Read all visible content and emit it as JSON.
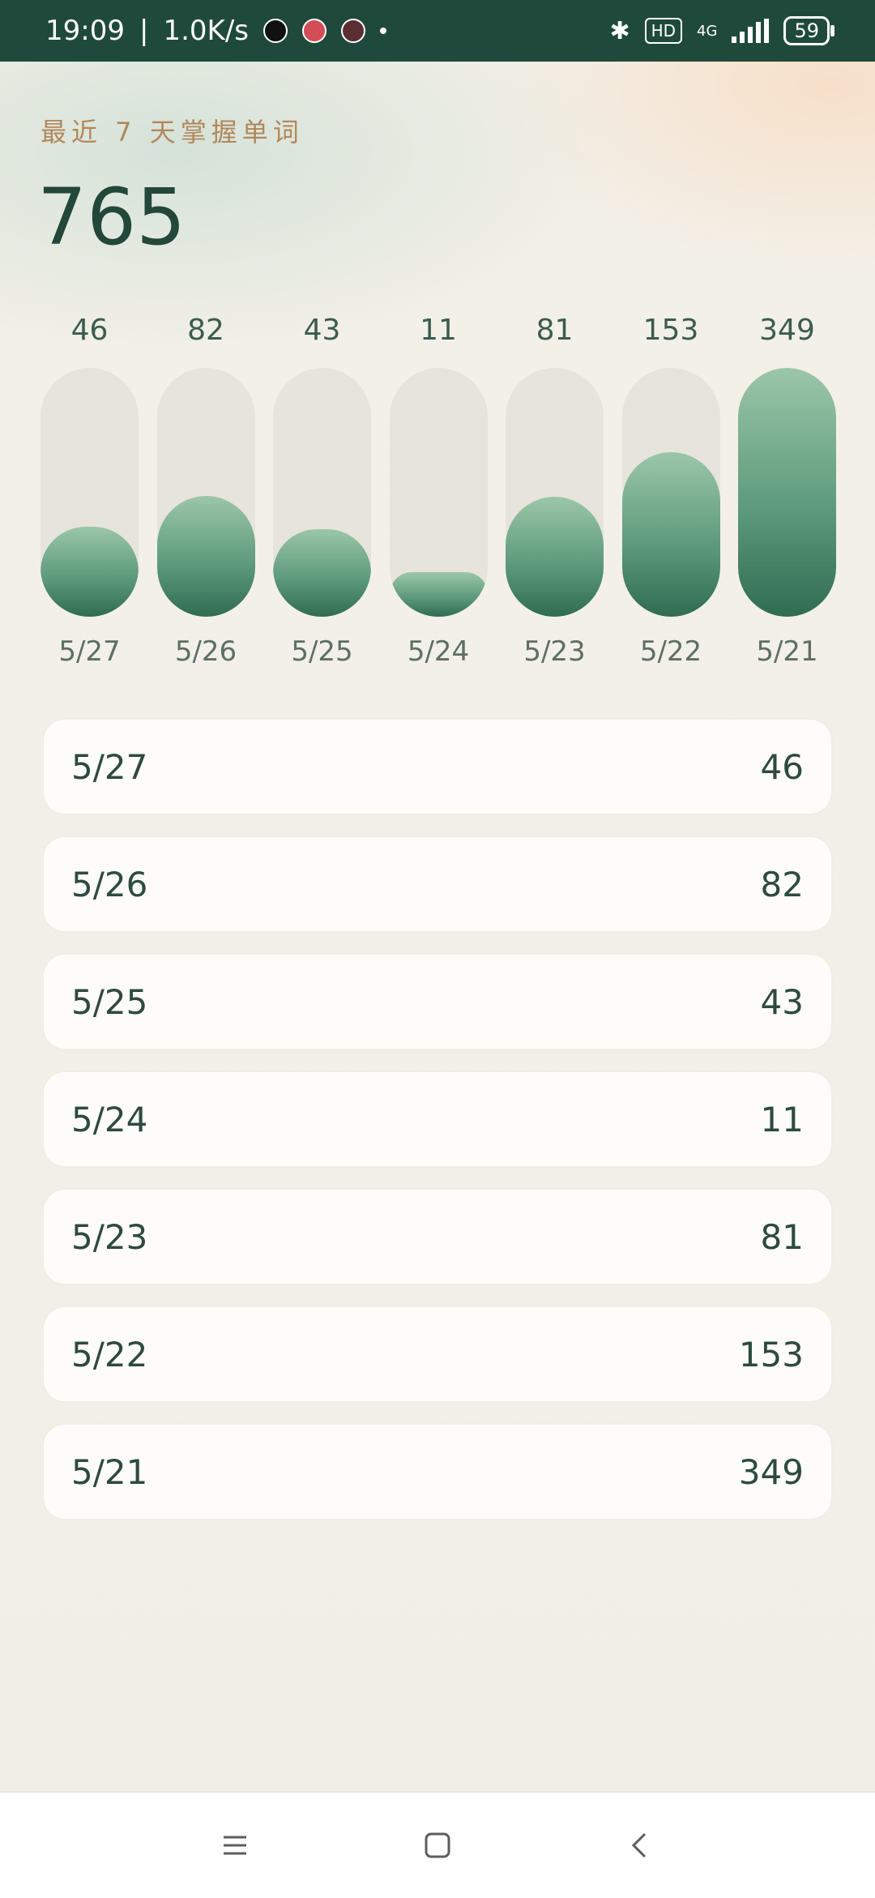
{
  "status_bar": {
    "time": "19:09",
    "speed": "1.0K/s",
    "battery": "59",
    "hd_label": "HD",
    "network_label": "4G",
    "icons": [
      "tiktok-icon",
      "red-app-icon",
      "game-app-icon",
      "bluetooth-icon",
      "signal-icon",
      "battery-icon"
    ]
  },
  "header": {
    "subtitle": "最近 7 天掌握单词",
    "total": "765"
  },
  "chart_data": {
    "type": "bar",
    "categories": [
      "5/27",
      "5/26",
      "5/25",
      "5/24",
      "5/23",
      "5/22",
      "5/21"
    ],
    "values": [
      46,
      82,
      43,
      11,
      81,
      153,
      349
    ],
    "ylim": [
      0,
      349
    ],
    "title": "",
    "xlabel": "",
    "ylabel": ""
  },
  "list": [
    {
      "date": "5/27",
      "count": "46"
    },
    {
      "date": "5/26",
      "count": "82"
    },
    {
      "date": "5/25",
      "count": "43"
    },
    {
      "date": "5/24",
      "count": "11"
    },
    {
      "date": "5/23",
      "count": "81"
    },
    {
      "date": "5/22",
      "count": "153"
    },
    {
      "date": "5/21",
      "count": "349"
    }
  ],
  "colors": {
    "accent": "#1f4a3b",
    "bar_fill_top": "#9cc6a9",
    "bar_fill_bottom": "#2f6c52",
    "subtitle": "#b1885b"
  },
  "navigation": {
    "buttons": [
      "menu-icon",
      "home-icon",
      "back-icon"
    ]
  }
}
